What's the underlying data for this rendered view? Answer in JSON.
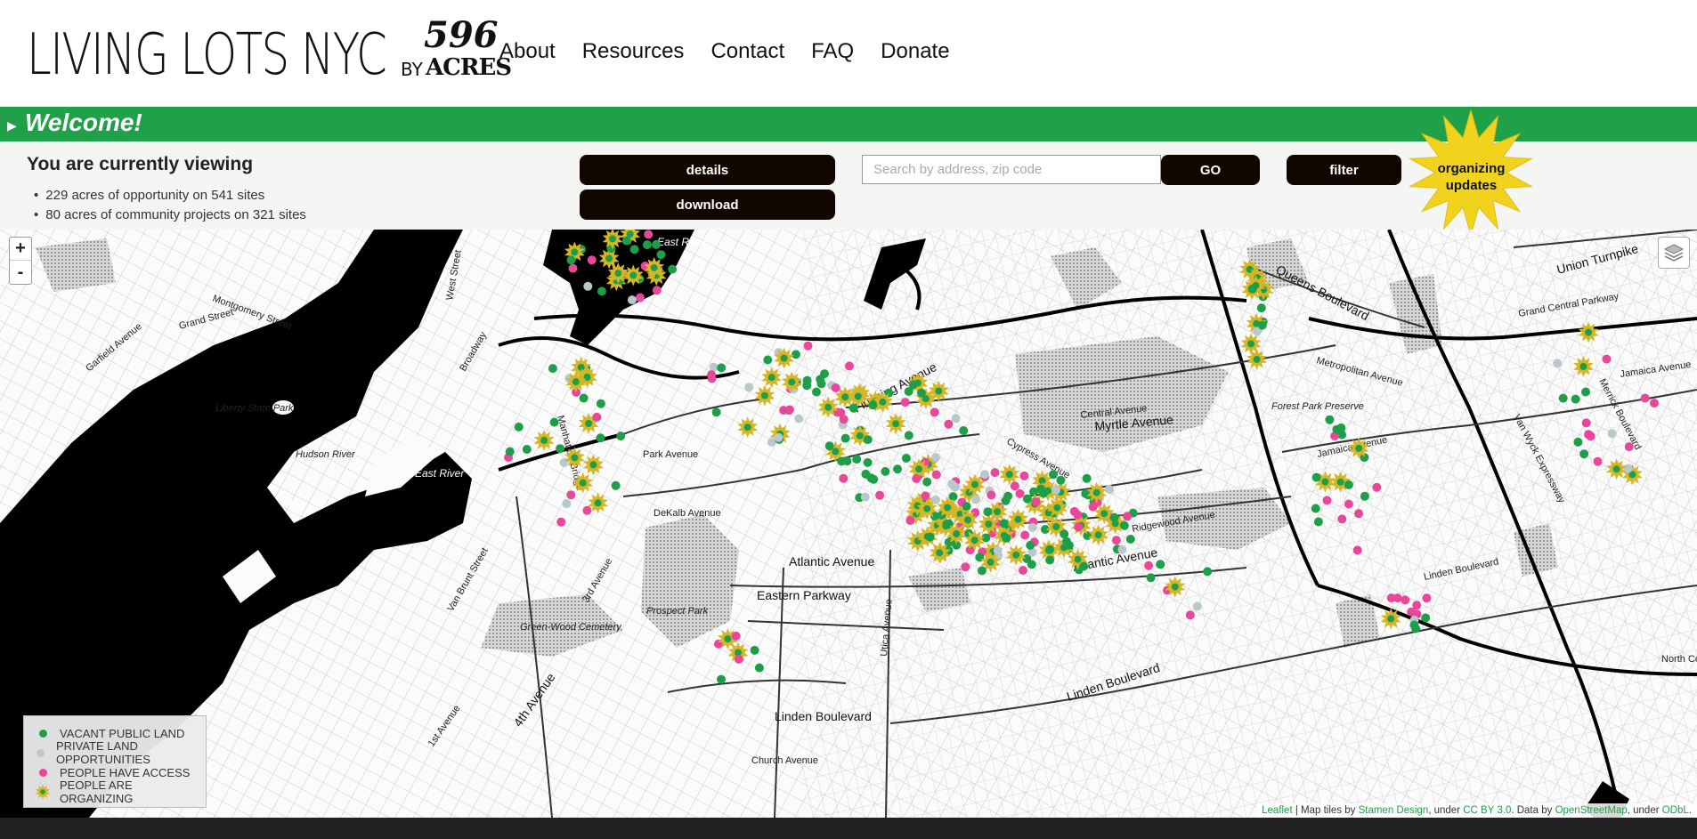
{
  "header": {
    "logo_main": "LIVING LOTS NYC",
    "logo_by": "BY",
    "logo_596": "596",
    "logo_acres": "ACRES",
    "nav": [
      "About",
      "Resources",
      "Contact",
      "FAQ",
      "Donate"
    ]
  },
  "welcome": {
    "label": "Welcome!"
  },
  "panel": {
    "title": "You are currently viewing",
    "stats": [
      "229 acres of opportunity on 541 sites",
      "80 acres of community projects on 321 sites"
    ],
    "details_label": "details",
    "download_label": "download",
    "search_placeholder": "Search by address, zip code",
    "go_label": "GO",
    "filter_label": "filter",
    "organizing_label_1": "organizing",
    "organizing_label_2": "updates"
  },
  "map": {
    "zoom_in": "+",
    "zoom_out": "-",
    "labels": {
      "east_river_1": "East River",
      "east_river_2": "East River",
      "hudson_river": "Hudson River",
      "liberty_park": "Liberty State Park",
      "prospect_park": "Prospect Park",
      "green_wood": "Green-Wood Cemetery",
      "forest_park": "Forest Park Preserve",
      "atlantic_1": "Atlantic Avenue",
      "atlantic_2": "Atlantic Avenue",
      "eastern_parkway": "Eastern Parkway",
      "linden_1": "Linden Boulevard",
      "linden_2": "Linden Boulevard",
      "linden_3": "Linden Boulevard",
      "myrtle": "Myrtle Avenue",
      "flushing": "Flushing Avenue",
      "queens_blvd": "Queens Boulevard",
      "union_tpk": "Union Turnpike",
      "jamaica_1": "Jamaica Avenue",
      "jamaica_2": "Jamaica Avenue",
      "metropolitan": "Metropolitan Avenue",
      "grand_central": "Grand Central Parkway",
      "park_ave": "Park Avenue",
      "dekalb": "DeKalb Avenue",
      "ridgewood": "Ridgewood Avenue",
      "cypress": "Cypress Avenue",
      "central_ave": "Central Avenue",
      "north_conduit": "North Conduit",
      "church_ave": "Church Avenue",
      "fourth_ave": "4th Avenue",
      "third_ave": "3rd Avenue",
      "first_ave": "1st Avenue",
      "manhattan_bridge": "Manhattan Bridge",
      "broadway": "Broadway",
      "west_street": "West Street",
      "grand_street": "Grand Street",
      "montgomery": "Montgomery Street",
      "garfield": "Garfield Avenue",
      "van_brunt": "Van Brunt Street",
      "utica": "Utica Avenue",
      "van_wyck": "Van Wyck Expressway",
      "merrick": "Merrick Boulevard"
    }
  },
  "legend": {
    "items": [
      {
        "label": "VACANT PUBLIC LAND",
        "color": "#1e9e48",
        "symbol": "dot"
      },
      {
        "label": "PRIVATE LAND OPPORTUNITIES",
        "color": "#b8c8cc",
        "symbol": "dot"
      },
      {
        "label": "PEOPLE HAVE ACCESS",
        "color": "#e8479a",
        "symbol": "dot"
      },
      {
        "label": "PEOPLE ARE ORGANIZING",
        "color": "#d4b626",
        "symbol": "star"
      }
    ]
  },
  "attribution": {
    "leaflet": "Leaflet",
    "t1": " | Map tiles by ",
    "stamen": "Stamen Design",
    "t2": ", under ",
    "ccby": "CC BY 3.0",
    "t3": ". Data by ",
    "osm": "OpenStreetMap",
    "t4": ", under ",
    "odbl": "ODbL",
    "t5": "."
  },
  "colors": {
    "accent_green": "#21a04a",
    "dark_button": "#110600",
    "star_yellow": "#f1d21c",
    "pink": "#e8479a"
  }
}
